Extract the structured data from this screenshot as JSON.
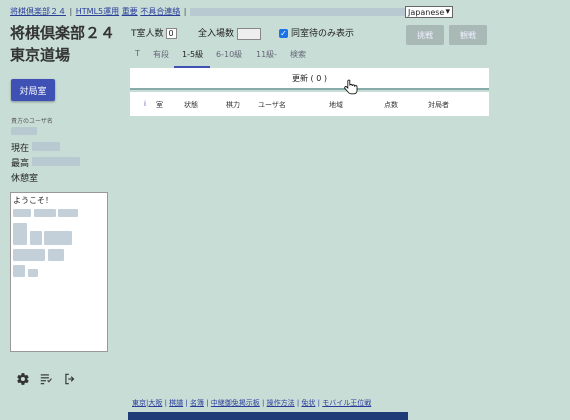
{
  "top_links": [
    "将棋倶楽部２４",
    "HTML5運用",
    "重要",
    "不具合連絡"
  ],
  "language": {
    "selected": "Japanese"
  },
  "site_title_line1": "将棋倶楽部２４",
  "site_title_line2": "東京道場",
  "room_button": "対局室",
  "user_label": "貴方のユーザ名",
  "rating_current_label": "現在",
  "rating_max_label": "最高",
  "rest_room_label": "休憩室",
  "message_greeting": "ようこそ！",
  "stats": {
    "t_room_label": "T室人数",
    "t_room_count": "0",
    "total_label": "全入場数",
    "same_room_label": "同室待のみ表示"
  },
  "action_buttons": {
    "challenge": "挑戦",
    "watch": "観戦"
  },
  "tabs": [
    "T",
    "有段",
    "1-5級",
    "6-10級",
    "11級-",
    "検索"
  ],
  "refresh_label": "更新 ( 0 )",
  "table_headers": [
    "i",
    "室",
    "状態",
    "棋力",
    "ユーザ名",
    "地域",
    "点数",
    "対局者"
  ],
  "bottom_links": [
    "東京",
    "大阪",
    "棋譜",
    "名簿",
    "中継御免掲示板",
    "操作方法",
    "免状",
    "モバイル王位戦"
  ],
  "icons": [
    "gear-icon",
    "list-icon",
    "logout-icon",
    "pointer-hand-cursor-icon"
  ]
}
